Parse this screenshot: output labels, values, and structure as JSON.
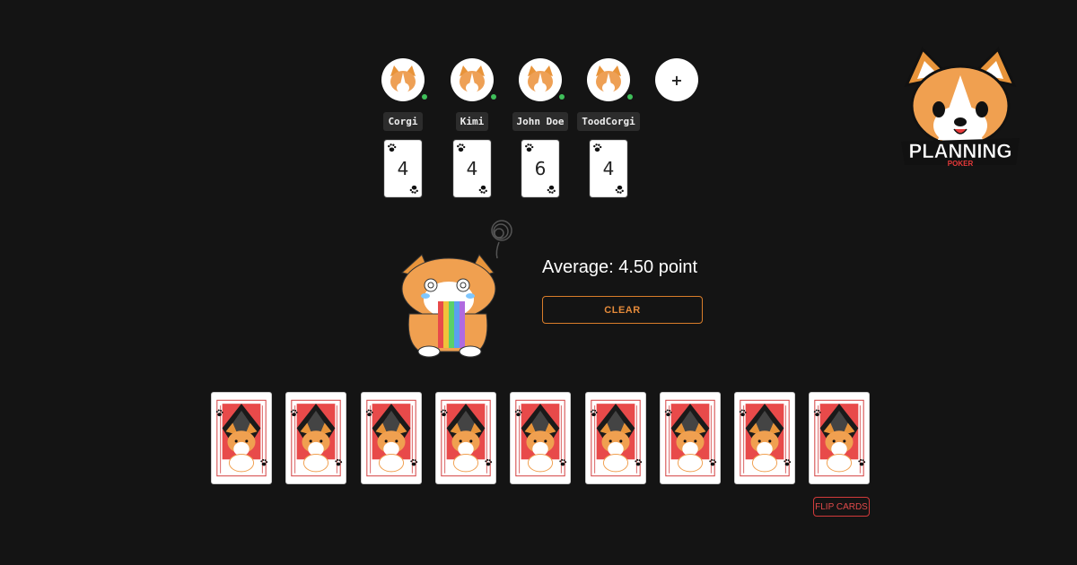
{
  "players": [
    {
      "name": "Corgi",
      "vote": "4",
      "online": true,
      "avatar_icon": "corgi-avatar-icon"
    },
    {
      "name": "Kimi",
      "vote": "4",
      "online": true,
      "avatar_icon": "corgi-avatar-icon"
    },
    {
      "name": "John Doe",
      "vote": "6",
      "online": true,
      "avatar_icon": "corgi-avatar-icon"
    },
    {
      "name": "ToodCorgi",
      "vote": "4",
      "online": true,
      "avatar_icon": "corgi-avatar-icon"
    }
  ],
  "add_player": {
    "label": "+"
  },
  "logo": {
    "line1": "PLANNING",
    "line2": "POKER"
  },
  "result": {
    "average_text": "Average: 4.50 point",
    "clear_label": "CLEAR"
  },
  "deck": {
    "card_count": 9,
    "card_back_icon": "corgi-card-back-icon"
  },
  "flip_label": "FLIP CARDS",
  "colors": {
    "accent_orange": "#d97d2a",
    "flip_red": "#d23a3a",
    "online_green": "#3fbf5a",
    "background": "#141414"
  }
}
